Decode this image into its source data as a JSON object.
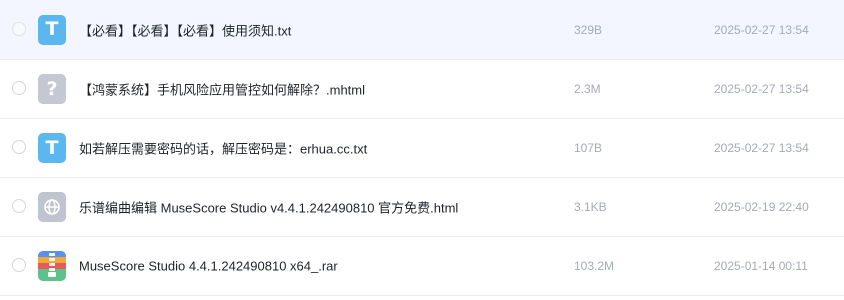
{
  "files": [
    {
      "name": "【必看】【必看】【必看】使用须知.txt",
      "size": "329B",
      "date": "2025-02-27 13:54",
      "icon": "txt-file-icon",
      "icon_glyph": "T"
    },
    {
      "name": "【鸿蒙系统】手机风险应用管控如何解除？.mhtml",
      "size": "2.3M",
      "date": "2025-02-27 13:54",
      "icon": "unknown-file-icon",
      "icon_glyph": "?"
    },
    {
      "name": "如若解压需要密码的话，解压密码是：erhua.cc.txt",
      "size": "107B",
      "date": "2025-02-27 13:54",
      "icon": "txt-file-icon",
      "icon_glyph": "T"
    },
    {
      "name": "乐谱编曲编辑 MuseScore Studio v4.4.1.242490810 官方免费.html",
      "size": "3.1KB",
      "date": "2025-02-19 22:40",
      "icon": "html-globe-icon"
    },
    {
      "name": "MuseScore Studio 4.4.1.242490810 x64_.rar",
      "size": "103.2M",
      "date": "2025-01-14 00:11",
      "icon": "rar-archive-icon"
    }
  ],
  "colors": {
    "selected_row_bg": "#f3f6ff",
    "txt_icon": "#5bb8ef",
    "meta_text": "#a6aab3"
  }
}
